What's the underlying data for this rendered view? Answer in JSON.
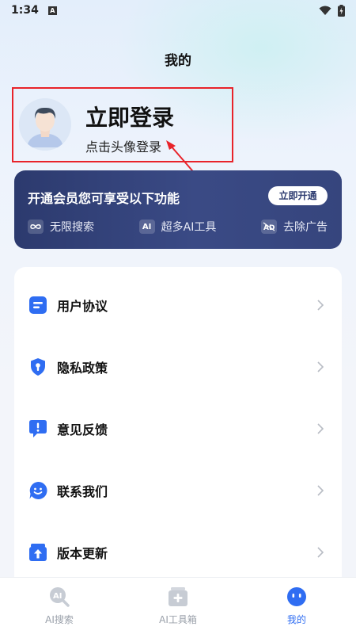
{
  "status_bar": {
    "time": "1:34",
    "sim_badge": "A"
  },
  "header": {
    "title": "我的"
  },
  "profile": {
    "title": "立即登录",
    "subtitle": "点击头像登录",
    "highlight_color": "#e8232a"
  },
  "vip": {
    "title": "开通会员您可享受以下功能",
    "button_label": "立即开通",
    "features": [
      {
        "icon": "infinity-icon",
        "label": "无限搜索"
      },
      {
        "icon": "ai-icon",
        "icon_text": "AI",
        "label": "超多AI工具"
      },
      {
        "icon": "no-ads-icon",
        "label": "去除广告"
      }
    ]
  },
  "menu": {
    "items": [
      {
        "icon": "document-icon",
        "label": "用户协议"
      },
      {
        "icon": "shield-icon",
        "label": "隐私政策"
      },
      {
        "icon": "feedback-icon",
        "label": "意见反馈"
      },
      {
        "icon": "smile-chat-icon",
        "label": "联系我们"
      },
      {
        "icon": "update-box-icon",
        "label": "版本更新"
      }
    ]
  },
  "tabbar": {
    "tabs": [
      {
        "icon": "ai-search-icon",
        "label": "AI搜索",
        "active": false
      },
      {
        "icon": "ai-toolbox-icon",
        "label": "AI工具箱",
        "active": false
      },
      {
        "icon": "mine-face-icon",
        "label": "我的",
        "active": true
      }
    ],
    "active_color": "#2f6df2",
    "inactive_color": "#9aa0aa"
  },
  "colors": {
    "accent": "#2f6df2",
    "vip_bg": "#34427a"
  }
}
